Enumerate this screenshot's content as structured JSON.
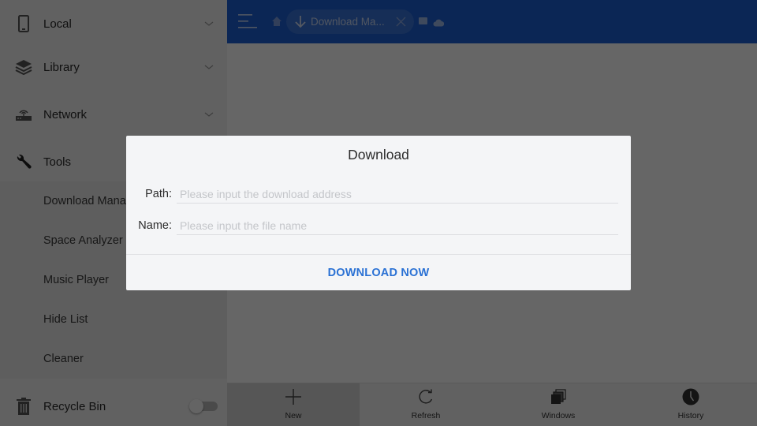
{
  "sidebar": {
    "sections": [
      {
        "label": "Local",
        "icon": "phone-icon",
        "expandable": true
      },
      {
        "label": "Library",
        "icon": "layers-icon",
        "expandable": true
      },
      {
        "label": "Network",
        "icon": "router-icon",
        "expandable": true
      },
      {
        "label": "Tools",
        "icon": "wrench-icon",
        "expandable": false
      }
    ],
    "tools_items": [
      {
        "label": "Download Manager"
      },
      {
        "label": "Space Analyzer"
      },
      {
        "label": "Music Player"
      },
      {
        "label": "Hide List"
      },
      {
        "label": "Cleaner"
      }
    ],
    "recycle_bin": {
      "label": "Recycle Bin",
      "icon": "trash-icon",
      "enabled": false
    }
  },
  "header": {
    "menu_icon": "hamburger-icon",
    "home_icon": "home-icon",
    "active_tab": {
      "label": "Download Ma...",
      "icon": "download-arrow-icon",
      "close_icon": "close-icon"
    },
    "extra_icons": [
      "window-icon",
      "cloud-icon"
    ],
    "color": "#1c5fd4"
  },
  "toolbar": {
    "buttons": [
      {
        "label": "New",
        "icon": "plus-icon",
        "selected": true
      },
      {
        "label": "Refresh",
        "icon": "refresh-icon",
        "selected": false
      },
      {
        "label": "Windows",
        "icon": "windows-icon",
        "selected": false
      },
      {
        "label": "History",
        "icon": "clock-icon",
        "selected": false
      }
    ]
  },
  "dialog": {
    "title": "Download",
    "path": {
      "label": "Path:",
      "value": "",
      "placeholder": "Please input the download address"
    },
    "name": {
      "label": "Name:",
      "value": "",
      "placeholder": "Please input the file name"
    },
    "action_label": "DOWNLOAD NOW",
    "action_color": "#2a71d4"
  }
}
